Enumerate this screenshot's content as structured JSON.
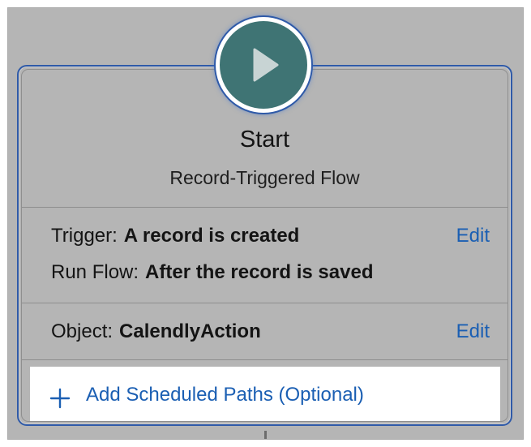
{
  "start_node": {
    "icon": "play-icon",
    "title": "Start",
    "subtitle": "Record-Triggered Flow"
  },
  "trigger_section": {
    "trigger_label": "Trigger:",
    "trigger_value": "A record is created",
    "run_flow_label": "Run Flow:",
    "run_flow_value": "After the record is saved",
    "edit_label": "Edit"
  },
  "object_section": {
    "object_label": "Object:",
    "object_value": "CalendlyAction",
    "edit_label": "Edit"
  },
  "scheduled_paths": {
    "icon": "plus-icon",
    "label": "Add Scheduled Paths (Optional)"
  },
  "colors": {
    "canvas_background": "#b5b5b5",
    "node_circle": "#3f7474",
    "selection_outline": "#2f5aa8",
    "link": "#1b5fb3"
  }
}
